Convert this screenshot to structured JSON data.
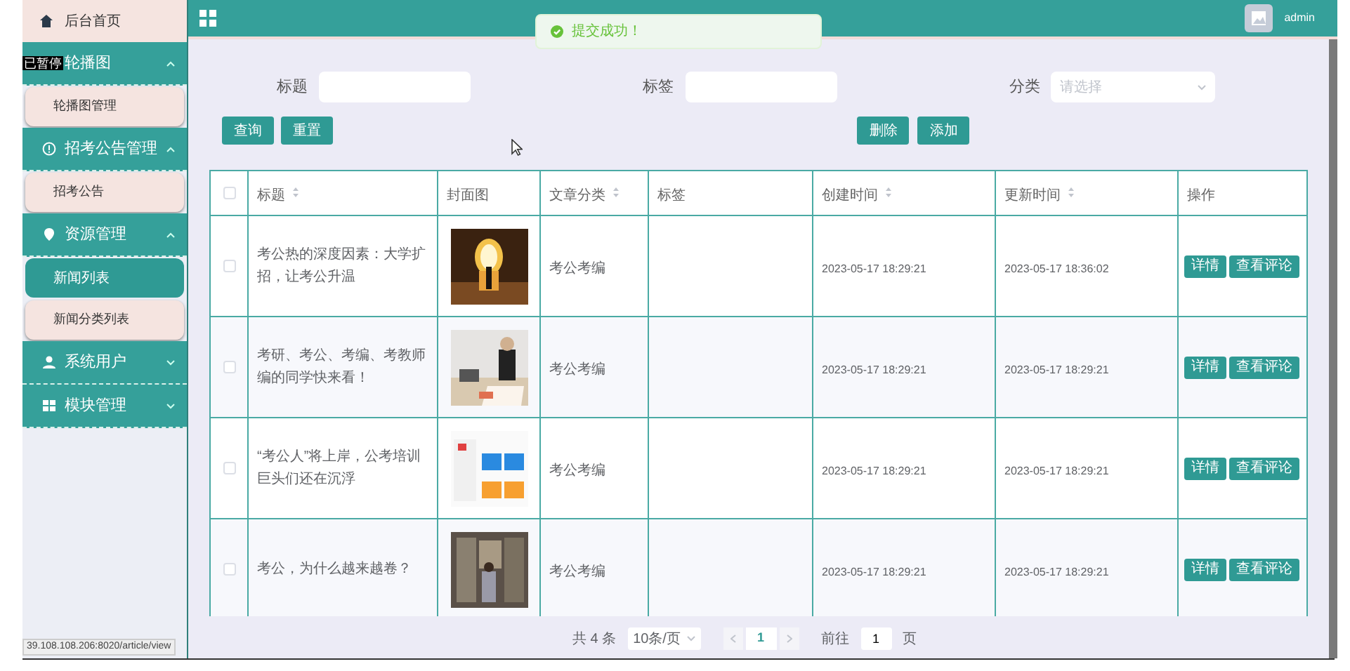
{
  "menu": [
    {
      "kind": "link",
      "label": "后台首页"
    },
    {
      "kind": "group",
      "label": "轮播图",
      "expanded": true,
      "children": [
        {
          "label": "轮播图管理",
          "selected": false
        }
      ]
    },
    {
      "kind": "group",
      "label": "招考公告管理",
      "expanded": true,
      "children": [
        {
          "label": "招考公告",
          "selected": false
        }
      ]
    },
    {
      "kind": "group",
      "label": "资源管理",
      "expanded": true,
      "children": [
        {
          "label": "新闻列表",
          "selected": true
        },
        {
          "label": "新闻分类列表",
          "selected": false
        }
      ]
    },
    {
      "kind": "group",
      "label": "系统用户",
      "expanded": false
    },
    {
      "kind": "group",
      "label": "模块管理",
      "expanded": false
    }
  ],
  "overlay_label": "已暂停",
  "header": {
    "user": "admin"
  },
  "toast": {
    "text": "提交成功！"
  },
  "filters": [
    {
      "kind": "input",
      "label": "标题"
    },
    {
      "kind": "input",
      "label": "标签"
    },
    {
      "kind": "select",
      "label": "分类",
      "placeholder": "请选择"
    }
  ],
  "search_buttons": [
    "查询",
    "重置"
  ],
  "action_buttons": [
    "删除",
    "添加"
  ],
  "table": {
    "select_all_checked": false,
    "columns": [
      {
        "label": "标题",
        "sortable": true
      },
      {
        "label": "封面图",
        "sortable": false
      },
      {
        "label": "文章分类",
        "sortable": true
      },
      {
        "label": "标签",
        "sortable": false
      },
      {
        "label": "创建时间",
        "sortable": true
      },
      {
        "label": "更新时间",
        "sortable": true
      },
      {
        "label": "操作",
        "sortable": false
      }
    ],
    "rows": [
      {
        "checked": false,
        "title": "考公热的深度因素：大学扩招，让考公升温",
        "cover": {
          "kind": "picture"
        },
        "category": "考公考编",
        "created": "2023-05-17 18:29:21",
        "updated": "2023-05-17 18:36:02",
        "actions": [
          "详情",
          "查看评论"
        ]
      },
      {
        "checked": false,
        "title": "考研、考公、考编、考教师编的同学快来看！",
        "cover": {
          "kind": "picture"
        },
        "category": "考公考编",
        "created": "2023-05-17 18:29:21",
        "updated": "2023-05-17 18:29:21",
        "actions": [
          "详情",
          "查看评论"
        ]
      },
      {
        "checked": false,
        "title": "“考公人”将上岸，公考培训巨头们还在沉浮",
        "cover": {
          "kind": "picture"
        },
        "category": "考公考编",
        "created": "2023-05-17 18:29:21",
        "updated": "2023-05-17 18:29:21",
        "actions": [
          "详情",
          "查看评论"
        ]
      },
      {
        "checked": false,
        "title": "考公，为什么越来越卷？",
        "cover": {
          "kind": "picture"
        },
        "category": "考公考编",
        "created": "2023-05-17 18:29:21",
        "updated": "2023-05-17 18:29:21",
        "actions": [
          "详情",
          "查看评论"
        ]
      }
    ]
  },
  "pagination": {
    "total": "共 4 条",
    "page_size": "10条/页",
    "pages": [
      {
        "label": "1",
        "selected": true
      }
    ],
    "goto_label": "前往",
    "goto_value": "1",
    "goto_suffix": "页"
  },
  "status_url": "39.108.108.206:8020/article/view"
}
